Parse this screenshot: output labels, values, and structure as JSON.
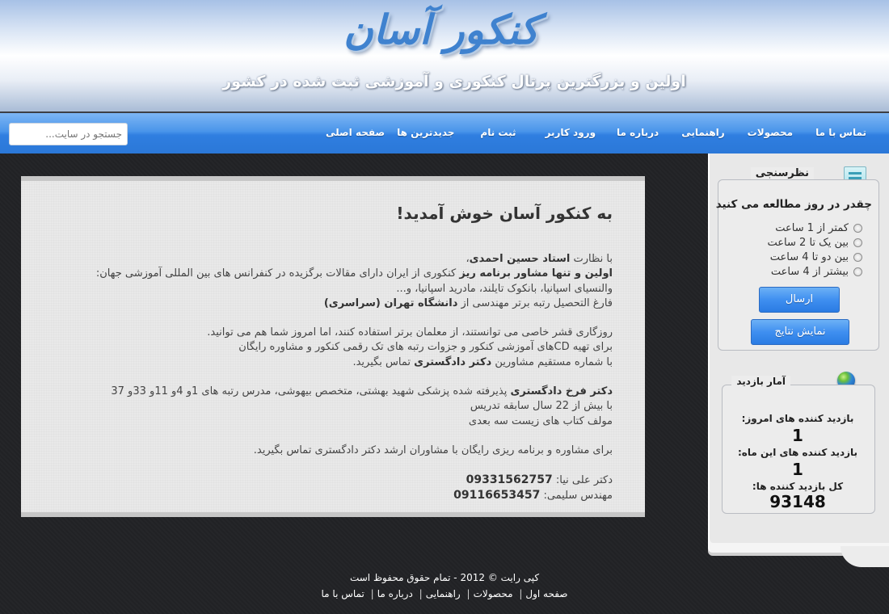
{
  "header": {
    "logo_text": "کنکور آسان",
    "tagline": "اولین و بزرگترین پرتال کنکوری و آموزشی ثبت شده در کشور"
  },
  "nav": {
    "items": [
      "صفحه اصلی",
      "جدیدترین ها",
      "ثبت نام",
      "ورود کاربر",
      "درباره ما",
      "راهنمایی",
      "محصولات",
      "تماس با ما"
    ],
    "search_placeholder": "جستجو در سایت..."
  },
  "content": {
    "title": "به کنکور آسان خوش آمدید!",
    "p1": {
      "l1_prefix": "با نظارت ",
      "l1_bold": "استاد حسین احمدی",
      "l1_suffix": "،",
      "l2_bold": "اولین و تنها مشاور برنامه ریز",
      "l2_rest": " کنکوری از ایران دارای مقالات برگزیده در کنفرانس های بین المللی آموزشی جهان:",
      "l3": "والنسیای اسپانیا، بانکوک تایلند، مادرید اسپانیا، و...",
      "l4_prefix": "فارغ التحصیل رتبه برتر مهندسی از ",
      "l4_bold": "دانشگاه تهران (سراسری)"
    },
    "p2": {
      "l1": "روزگاری قشر خاصی می توانستند، از معلمان برتر استفاده کنند، اما امروز شما هم می توانید.",
      "l2": "برای تهیه CDهای آموزشی کنکور و جزوات رتبه های تک رقمی کنکور و مشاوره رایگان",
      "l3_prefix": "با شماره مستقیم مشاورین ",
      "l3_bold": "دکتر دادگستری",
      "l3_suffix": " تماس بگیرید."
    },
    "p3": {
      "l1_bold": "دکتر فرخ دادگستری",
      "l1_rest": " پذیرفته شده پزشکی شهید بهشتی، متخصص بیهوشی، مدرس رتبه های 1و 4و 11و 33و 37",
      "l2": "با بیش از 22 سال سابقه تدریس",
      "l3": "مولف کتاب های زیست سه بعدی"
    },
    "p4": "برای مشاوره و برنامه ریزی رایگان با مشاوران ارشد دکتر دادگستری تماس بگیرید.",
    "contacts": [
      {
        "label": "دکتر علی نیا: ",
        "phone": "09331562757"
      },
      {
        "label": "مهندس سلیمی: ",
        "phone": "09116653457"
      }
    ]
  },
  "poll": {
    "title": "نظرسنجی",
    "question": "چقدر در روز مطالعه می کنید",
    "options": [
      "کمتر از 1 ساعت",
      "بین یک تا 2 ساعت",
      "بین دو تا 4 ساعت",
      "بیشتر از 4 ساعت"
    ],
    "submit_label": "ارسال",
    "results_label": "نمایش نتایج"
  },
  "stats": {
    "title": "آمار بازدید",
    "today_label": "بازدید کننده های امروز:",
    "today_value": "1",
    "month_label": "بازدید کننده های این ماه:",
    "month_value": "1",
    "total_label": "کل بازدید کننده ها:",
    "total_value": "93148"
  },
  "footer": {
    "copyright": "کپی رایت © 2012 - تمام حقوق محفوظ است",
    "links": [
      "صفحه اول",
      "محصولات",
      "راهنمایی",
      "درباره ما",
      "تماس با ما"
    ]
  },
  "colors": {
    "nav_blue": "#2f7ee0",
    "logo_blue": "#3f82cf",
    "background_dark": "#222326"
  }
}
